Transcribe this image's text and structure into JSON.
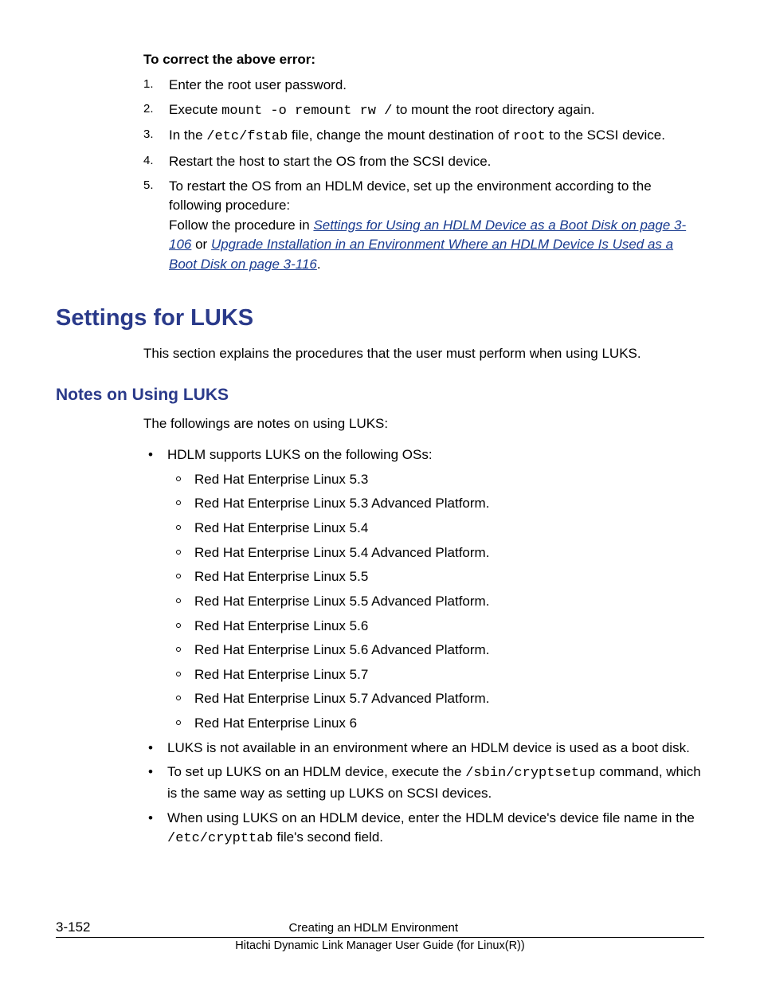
{
  "lead": "To correct the above error:",
  "steps": [
    {
      "num": "1",
      "parts": [
        {
          "t": "Enter the root user password."
        }
      ]
    },
    {
      "num": "2",
      "parts": [
        {
          "t": "Execute "
        },
        {
          "t": "mount -o remount rw /",
          "mono": true
        },
        {
          "t": " to mount the root directory again."
        }
      ]
    },
    {
      "num": "3",
      "parts": [
        {
          "t": "In the "
        },
        {
          "t": "/etc/fstab",
          "mono": true
        },
        {
          "t": " file, change the mount destination of "
        },
        {
          "t": "root",
          "mono": true
        },
        {
          "t": " to the SCSI device."
        }
      ]
    },
    {
      "num": "4",
      "parts": [
        {
          "t": "Restart the host to start the OS from the SCSI device."
        }
      ]
    },
    {
      "num": "5",
      "parts": [
        {
          "t": "To restart the OS from an HDLM device, set up the environment according to the following procedure:"
        }
      ],
      "follow": {
        "pre": "Follow the procedure in ",
        "link1": "Settings for Using an HDLM Device as a Boot Disk on page 3-106",
        "mid": " or ",
        "link2": "Upgrade Installation in an Environment Where an HDLM Device Is Used as a Boot Disk on page 3-116",
        "post": "."
      }
    }
  ],
  "section_title": "Settings for LUKS",
  "section_intro": "This section explains the procedures that the user must perform when using LUKS.",
  "subsection_title": "Notes on Using LUKS",
  "subsection_intro": "The followings are notes on using LUKS:",
  "luks_bullet1": "HDLM supports LUKS on the following OSs:",
  "os_list": [
    "Red Hat Enterprise Linux 5.3",
    "Red Hat Enterprise Linux 5.3 Advanced Platform.",
    "Red Hat Enterprise Linux 5.4",
    "Red Hat Enterprise Linux 5.4 Advanced Platform.",
    "Red Hat Enterprise Linux 5.5",
    "Red Hat Enterprise Linux 5.5 Advanced Platform.",
    "Red Hat Enterprise Linux 5.6",
    "Red Hat Enterprise Linux 5.6 Advanced Platform.",
    "Red Hat Enterprise Linux 5.7",
    "Red Hat Enterprise Linux 5.7 Advanced Platform.",
    "Red Hat Enterprise Linux 6"
  ],
  "luks_bullet2": "LUKS is not available in an environment where an HDLM device is used as a boot disk.",
  "luks_bullet3": {
    "pre": "To set up LUKS on an HDLM device, execute the ",
    "code": "/sbin/cryptsetup",
    "post": " command, which is the same way as setting up LUKS on SCSI devices."
  },
  "luks_bullet4": {
    "pre": "When using LUKS on an HDLM device, enter the HDLM device's device file name in the ",
    "code": "/etc/crypttab",
    "post": " file's second field."
  },
  "footer": {
    "page": "3-152",
    "line1": "Creating an HDLM Environment",
    "line2": "Hitachi Dynamic Link Manager User Guide (for Linux(R))"
  }
}
